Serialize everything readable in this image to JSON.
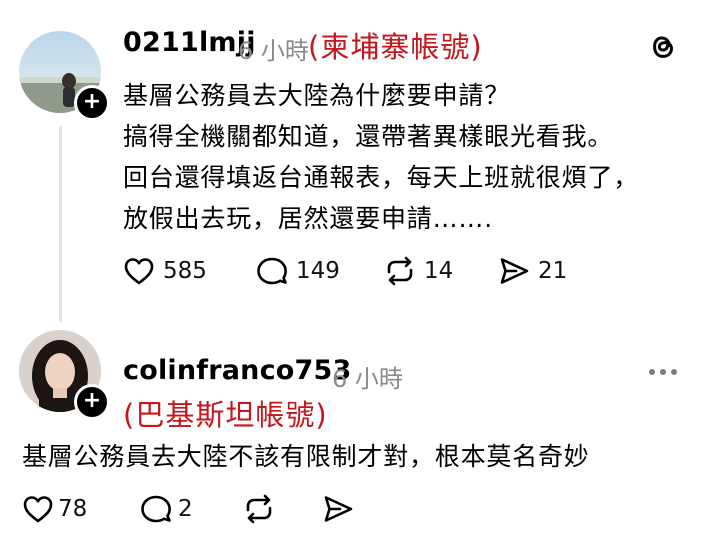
{
  "post1": {
    "username": "0211lmjj",
    "time": "6 小時",
    "tag": "(柬埔寨帳號)",
    "lines": [
      "基層公務員去大陸為什麼要申請？",
      "搞得全機關都知道，還帶著異樣眼光看我。",
      "回台還得填返台通報表，每天上班就很煩了，",
      "放假出去玩，居然還要申請……."
    ],
    "likes": "585",
    "comments": "149",
    "reposts": "14",
    "shares": "21"
  },
  "post2": {
    "username": "colinfranco753",
    "time": "6 小時",
    "tag": "(巴基斯坦帳號)",
    "text": "基層公務員去大陸不該有限制才對，根本莫名奇妙",
    "likes": "78",
    "comments": "2"
  },
  "icons": {
    "app": "threads-logo-icon",
    "more": "more-options-icon",
    "like": "heart-icon",
    "comment": "comment-bubble-icon",
    "repost": "repost-icon",
    "share": "send-icon",
    "follow": "plus-icon"
  },
  "colors": {
    "tag": "#c4161c",
    "muted": "#8a8a8a"
  }
}
